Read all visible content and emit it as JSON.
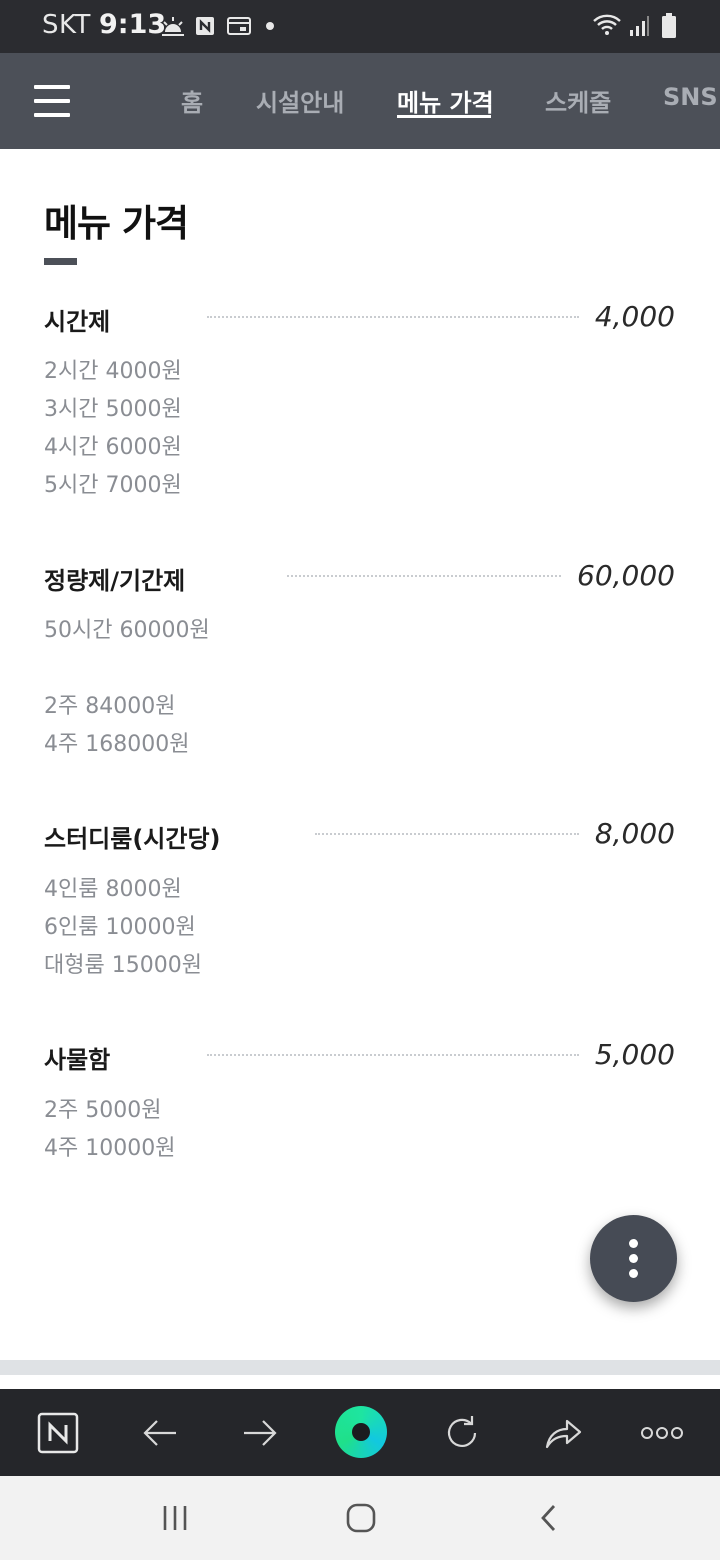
{
  "status_bar": {
    "carrier": "SKT",
    "time": "9:13",
    "icons": [
      "weather-icon",
      "naver-notification-icon",
      "card-notification-icon",
      "dot-icon",
      "wifi-icon",
      "signal-icon",
      "battery-icon"
    ]
  },
  "nav": {
    "menu_icon": "hamburger-icon",
    "tabs": [
      {
        "label": "홈",
        "active": false
      },
      {
        "label": "시설안내",
        "active": false
      },
      {
        "label": "메뉴 가격",
        "active": true
      },
      {
        "label": "스케줄",
        "active": false
      },
      {
        "label": "SNS",
        "active": false
      }
    ]
  },
  "page": {
    "title": "메뉴 가격",
    "sections": [
      {
        "title": "시간제",
        "price": "4,000",
        "lines": [
          "2시간 4000원",
          "3시간 5000원",
          "4시간 6000원",
          "5시간 7000원"
        ]
      },
      {
        "title": "정량제/기간제",
        "price": "60,000",
        "lines": [
          "50시간 60000원",
          "",
          "2주 84000원",
          "4주 168000원"
        ]
      },
      {
        "title": "스터디룸(시간당)",
        "price": "8,000",
        "lines": [
          "4인룸 8000원",
          "6인룸 10000원",
          "대형룸 15000원"
        ]
      },
      {
        "title": "사물함",
        "price": "5,000",
        "lines": [
          "2주 5000원",
          "4주 10000원"
        ]
      }
    ]
  },
  "fab": {
    "icon": "more-vertical-icon"
  },
  "browser_toolbar": {
    "buttons": [
      "naver-icon",
      "back-arrow-icon",
      "forward-arrow-icon",
      "home-circle-icon",
      "refresh-icon",
      "share-icon",
      "more-horizontal-icon"
    ]
  },
  "system_nav": {
    "buttons": [
      "recent-apps-icon",
      "home-icon",
      "back-icon"
    ]
  },
  "colors": {
    "nav_bg": "#4c5058",
    "status_bg": "#2b2c30",
    "toolbar_bg": "#25262a",
    "accent_green": "#1ee5a0"
  }
}
